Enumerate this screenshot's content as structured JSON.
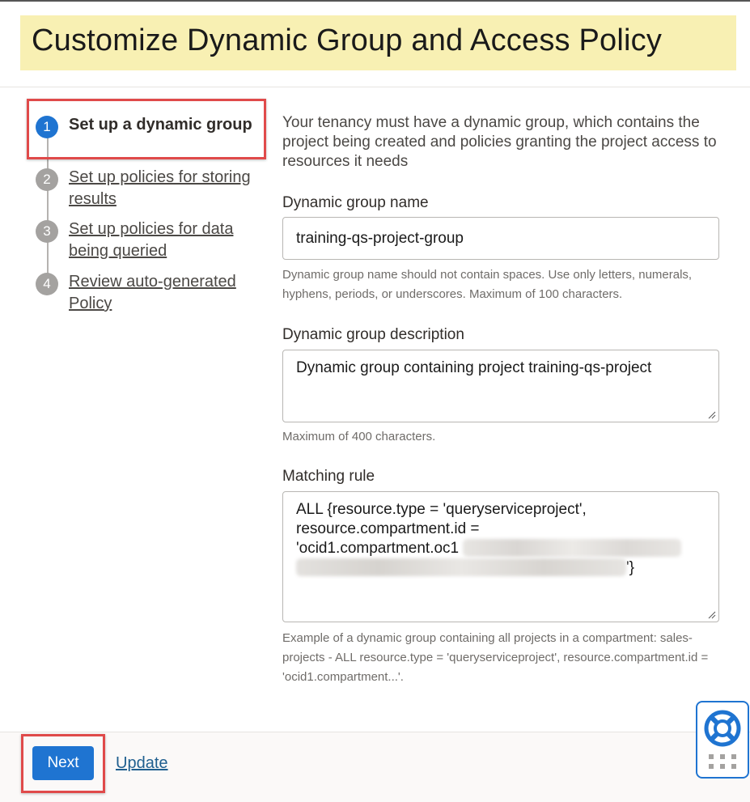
{
  "header": {
    "title": "Customize Dynamic Group and Access Policy"
  },
  "steps": [
    {
      "number": "1",
      "label": "Set up a dynamic group",
      "active": true
    },
    {
      "number": "2",
      "label": "Set up policies for storing results",
      "active": false
    },
    {
      "number": "3",
      "label": "Set up policies for data being queried",
      "active": false
    },
    {
      "number": "4",
      "label": "Review auto-generated Policy",
      "active": false
    }
  ],
  "form": {
    "intro": "Your tenancy must have a dynamic group, which contains the project being created and policies granting the project access to resources it needs",
    "group_name": {
      "label": "Dynamic group name",
      "value": "training-qs-project-group",
      "help": "Dynamic group name should not contain spaces. Use only letters, numerals, hyphens, periods, or underscores. Maximum of 100 characters."
    },
    "group_description": {
      "label": "Dynamic group description",
      "value": "Dynamic group containing project training-qs-project",
      "help": "Maximum of 400 characters."
    },
    "matching_rule": {
      "label": "Matching rule",
      "line1": "ALL {resource.type = 'queryserviceproject',",
      "line2": "resource.compartment.id =",
      "line3": "'ocid1.compartment.oc1",
      "line4_end": "'}",
      "help": "Example of a dynamic group containing all projects in a compartment: sales-projects - ALL resource.type = 'queryserviceproject', resource.compartment.id = 'ocid1.compartment...'."
    }
  },
  "footer": {
    "next_label": "Next",
    "update_label": "Update"
  },
  "icons": {
    "help": "lifebuoy-icon",
    "grid": "grid-dots-icon"
  },
  "colors": {
    "accent": "#1f74d1",
    "highlight": "#f8f0b3",
    "callout": "#e04a4a"
  }
}
